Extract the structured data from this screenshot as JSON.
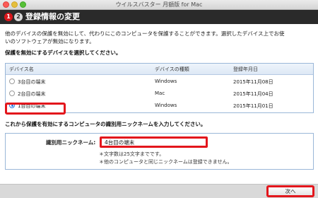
{
  "window": {
    "title": "ウイルスバスター 月額版 for Mac"
  },
  "header": {
    "step1": "1",
    "step2": "2",
    "title": "登録情報の変更"
  },
  "intro": {
    "line1": "他のデバイスの保護を無効にして、代わりにこのコンピュータを保護することができます。選択したデバイス上でお使",
    "line2": "いのソフトウェアが無効になります。"
  },
  "device_section": {
    "label": "保護を無効にするデバイスを選択してください。",
    "columns": [
      "デバイス名",
      "デバイスの種類",
      "登録年月日"
    ],
    "rows": [
      {
        "name": "3台目の端末",
        "type": "Windows",
        "date": "2015年11月08日",
        "selected": false
      },
      {
        "name": "2台目の端末",
        "type": "Mac",
        "date": "2015年11月04日",
        "selected": false
      },
      {
        "name": "1台目の端末",
        "type": "Windows",
        "date": "2015年11月01日",
        "selected": true
      }
    ]
  },
  "nickname_section": {
    "label": "これから保護を有効にするコンピュータの識別用ニックネームを入力してください。",
    "field_label": "識別用ニックネーム:",
    "value": "4台目の端末",
    "note1": "＊文字数は25文字までです。",
    "note2": "＊他のコンピュータと同じニックネームは登録できません。"
  },
  "footer": {
    "next_label": "次へ"
  },
  "colors": {
    "accent_red": "#e3161c",
    "header_bg": "#2a2a2a",
    "radio_blue": "#2a7ae2"
  }
}
